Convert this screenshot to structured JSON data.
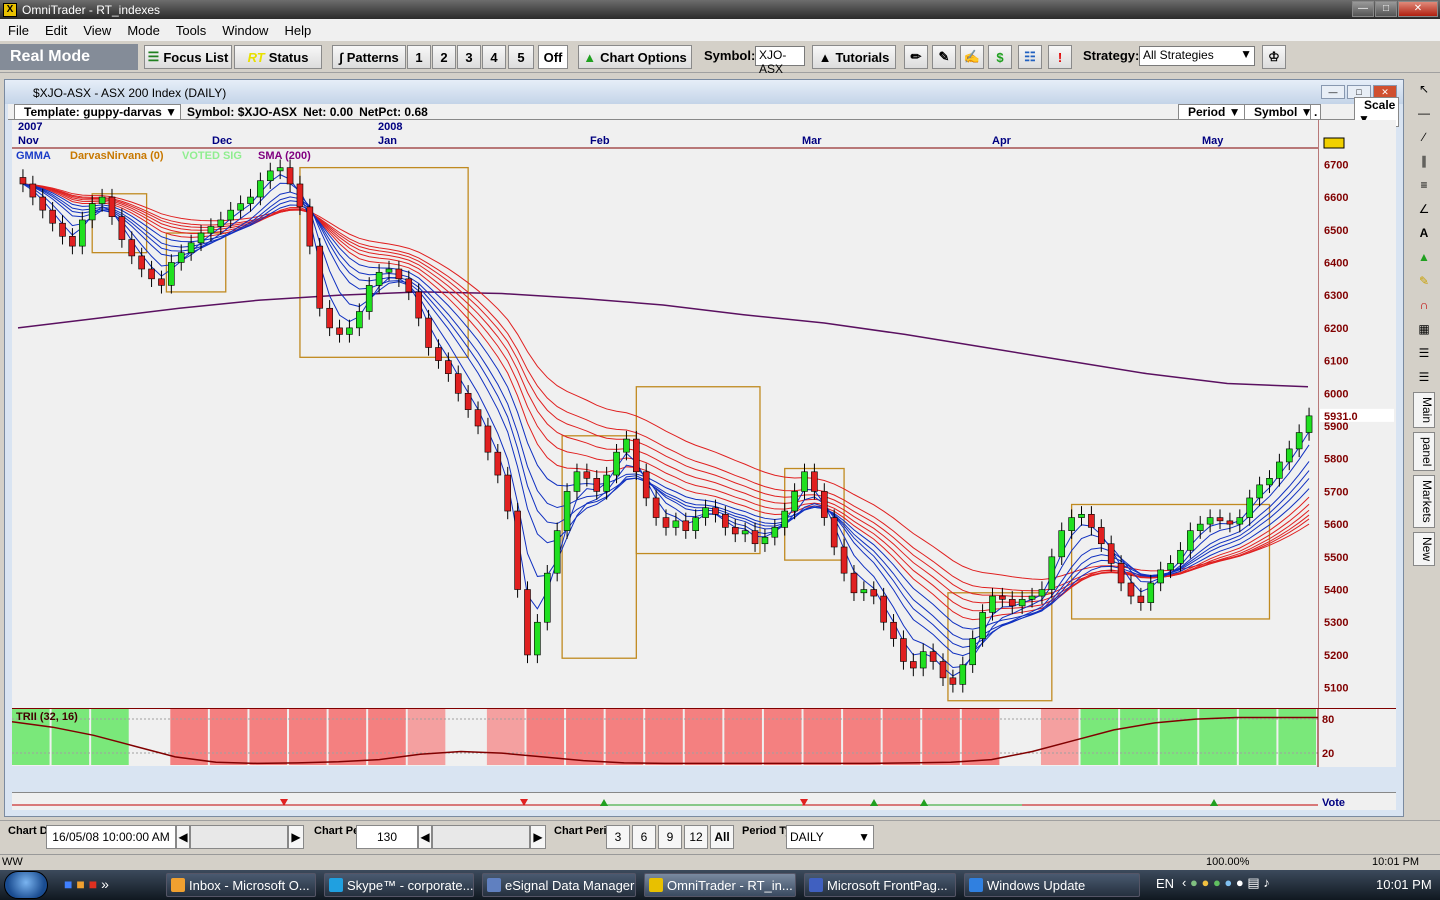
{
  "app": {
    "title": "OmniTrader - RT_indexes"
  },
  "menu": [
    "File",
    "Edit",
    "View",
    "Mode",
    "Tools",
    "Window",
    "Help"
  ],
  "toolbar": {
    "mode": "Real Mode",
    "focus_list": "Focus List",
    "rt": "RT",
    "status": "Status",
    "patterns": "Patterns",
    "pattern_nums": [
      "1",
      "2",
      "3",
      "4",
      "5",
      "Off"
    ],
    "chart_options": "Chart Options",
    "symbol_label": "Symbol:",
    "symbol_value": "XJO-ASX",
    "tutorials": "Tutorials",
    "strategy_label": "Strategy:",
    "strategy_value": "All Strategies"
  },
  "chart_window": {
    "title": "$XJO-ASX - ASX 200 Index (DAILY)",
    "template": "Template: guppy-darvas",
    "symbol": "Symbol: $XJO-ASX",
    "net": "Net: 0.00",
    "netpct": "NetPct: 0.68",
    "period_btn": "Period",
    "symbol_btn": "Symbol",
    "scale_btn": "Scale",
    "dot_btn": "."
  },
  "chart_data": {
    "type": "line",
    "time_labels": [
      {
        "year": "2007",
        "month": "Nov"
      },
      {
        "year": "",
        "month": "Dec"
      },
      {
        "year": "2008",
        "month": "Jan"
      },
      {
        "year": "",
        "month": "Feb"
      },
      {
        "year": "",
        "month": "Mar"
      },
      {
        "year": "",
        "month": "Apr"
      },
      {
        "year": "",
        "month": "May"
      }
    ],
    "legend": [
      {
        "name": "GMMA",
        "color": "#1a3cc8"
      },
      {
        "name": "DarvasNirvana (0)",
        "color": "#c87800"
      },
      {
        "name": "VOTED SIG",
        "color": "#90ee90"
      },
      {
        "name": "SMA (200)",
        "color": "#800080"
      }
    ],
    "ylim": [
      5050,
      6750
    ],
    "y_ticks": [
      6700,
      6600,
      6500,
      6400,
      6300,
      6200,
      6100,
      6000,
      5900,
      5800,
      5700,
      5600,
      5500,
      5400,
      5300,
      5200,
      5100
    ],
    "last_price": "5931.0",
    "closes": [
      6640,
      6600,
      6560,
      6520,
      6480,
      6450,
      6530,
      6580,
      6600,
      6540,
      6470,
      6420,
      6380,
      6350,
      6330,
      6400,
      6430,
      6460,
      6490,
      6510,
      6530,
      6560,
      6580,
      6600,
      6650,
      6680,
      6690,
      6640,
      6570,
      6450,
      6260,
      6200,
      6180,
      6200,
      6250,
      6330,
      6370,
      6380,
      6350,
      6310,
      6230,
      6140,
      6100,
      6060,
      6000,
      5950,
      5900,
      5820,
      5750,
      5640,
      5400,
      5200,
      5300,
      5450,
      5580,
      5700,
      5760,
      5740,
      5700,
      5750,
      5820,
      5860,
      5760,
      5680,
      5620,
      5590,
      5610,
      5580,
      5620,
      5650,
      5630,
      5590,
      5570,
      5580,
      5540,
      5560,
      5590,
      5640,
      5700,
      5760,
      5700,
      5620,
      5530,
      5450,
      5390,
      5400,
      5380,
      5300,
      5250,
      5180,
      5160,
      5210,
      5180,
      5130,
      5110,
      5170,
      5250,
      5330,
      5380,
      5370,
      5350,
      5370,
      5380,
      5400,
      5500,
      5580,
      5620,
      5630,
      5590,
      5540,
      5480,
      5420,
      5380,
      5360,
      5420,
      5460,
      5480,
      5520,
      5580,
      5600,
      5620,
      5610,
      5600,
      5620,
      5680,
      5720,
      5740,
      5790,
      5830,
      5880,
      5931
    ],
    "sma200": [
      6200,
      6230,
      6260,
      6285,
      6300,
      6310,
      6305,
      6290,
      6270,
      6240,
      6215,
      6180,
      6140,
      6100,
      6060,
      6030,
      6020
    ],
    "darvas_boxes": [
      {
        "x0": 14,
        "x1": 25,
        "top": 6610,
        "bottom": 6430
      },
      {
        "x0": 29,
        "x1": 41,
        "top": 6490,
        "bottom": 6310
      },
      {
        "x0": 56,
        "x1": 90,
        "top": 6690,
        "bottom": 6110
      },
      {
        "x0": 109,
        "x1": 124,
        "top": 5870,
        "bottom": 5190
      },
      {
        "x0": 124,
        "x1": 149,
        "top": 6020,
        "bottom": 5510
      },
      {
        "x0": 154,
        "x1": 166,
        "top": 5770,
        "bottom": 5490
      },
      {
        "x0": 187,
        "x1": 208,
        "top": 5390,
        "bottom": 5060
      },
      {
        "x0": 212,
        "x1": 252,
        "top": 5660,
        "bottom": 5310
      }
    ],
    "trend_indicator": {
      "label": "TRII (32, 16)",
      "levels": [
        "80",
        "20",
        "1000"
      ],
      "values": [
        80,
        70,
        55,
        35,
        15,
        5,
        3,
        4,
        6,
        10,
        20,
        25,
        22,
        15,
        8,
        4,
        3,
        3,
        3,
        3,
        3,
        3,
        4,
        5,
        10,
        25,
        45,
        65,
        78,
        85,
        88,
        88,
        88
      ]
    },
    "vote_label": "Vote"
  },
  "bottom": {
    "chart_date_label": "Chart Date",
    "chart_date": "16/05/08 10:00:00 AM",
    "chart_periods_label": "Chart Periods",
    "chart_periods": "130",
    "chart_periods2_label": "Chart Periods",
    "period_buttons": [
      "3",
      "6",
      "9",
      "12",
      "All"
    ],
    "period_type_label": "Period Type",
    "period_type": "DAILY"
  },
  "statusbar": {
    "zoom": "100.00%",
    "time": "10:01 PM",
    "w": "WW"
  },
  "taskbar": {
    "tasks": [
      {
        "label": "Inbox - Microsoft O...",
        "color": "#f0a030"
      },
      {
        "label": "Skype™ - corporate...",
        "color": "#20a0e0"
      },
      {
        "label": "eSignal Data Manager",
        "color": "#6080c0"
      },
      {
        "label": "OmniTrader - RT_in...",
        "color": "#e8c000"
      },
      {
        "label": "Microsoft FrontPag...",
        "color": "#4060c0"
      },
      {
        "label": "Windows Update",
        "color": "#3080e0"
      }
    ],
    "lang": "EN",
    "clock": "10:01 PM"
  }
}
